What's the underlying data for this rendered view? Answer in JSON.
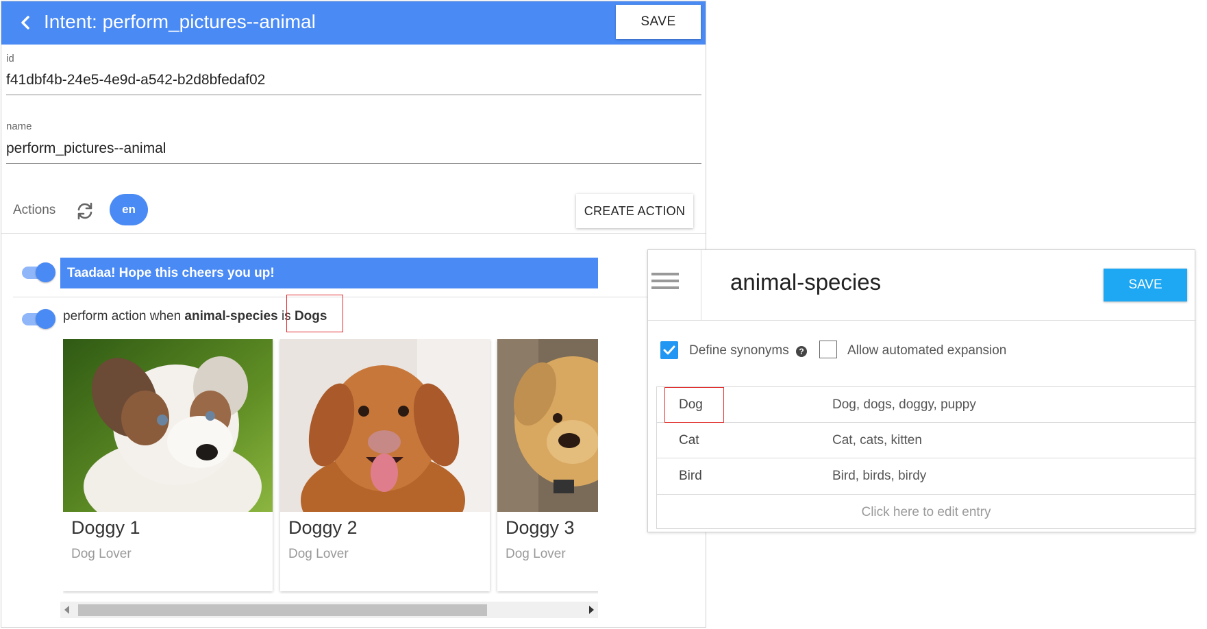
{
  "intent": {
    "title": "Intent: perform_pictures--animal",
    "save_label": "SAVE",
    "id_label": "id",
    "id_value": "f41dbf4b-24e5-4e9d-a542-b2d8bfedaf02",
    "name_label": "name",
    "name_value": "perform_pictures--animal",
    "actions_label": "Actions",
    "language_chip": "en",
    "create_action_label": "CREATE ACTION",
    "message_text": "Taadaa! Hope this cheers you up!",
    "condition": {
      "prefix": "perform action when ",
      "entity": "animal-species",
      "middle": " is ",
      "value": "Dogs"
    },
    "cards": [
      {
        "title": "Doggy 1",
        "subtitle": "Dog Lover"
      },
      {
        "title": "Doggy 2",
        "subtitle": "Dog Lover"
      },
      {
        "title": "Doggy 3",
        "subtitle": "Dog Lover"
      }
    ]
  },
  "entity": {
    "title": "animal-species",
    "save_label": "SAVE",
    "define_synonyms_label": "Define synonyms",
    "define_synonyms_checked": true,
    "auto_expansion_label": "Allow automated expansion",
    "auto_expansion_checked": false,
    "entries": [
      {
        "key": "Dog",
        "synonyms": "Dog, dogs, doggy, puppy"
      },
      {
        "key": "Cat",
        "synonyms": "Cat, cats, kitten"
      },
      {
        "key": "Bird",
        "synonyms": "Bird, birds, birdy"
      }
    ],
    "edit_entry_label": "Click here to edit entry"
  },
  "icons": {
    "back": "chevron-left-icon",
    "refresh": "refresh-icon",
    "menu": "menu-icon",
    "help": "help-circle-icon",
    "check": "check-icon"
  },
  "colors": {
    "primary_blue": "#4a8af4",
    "entity_save_blue": "#1ea7f2",
    "highlight_red": "#e02a2a"
  }
}
